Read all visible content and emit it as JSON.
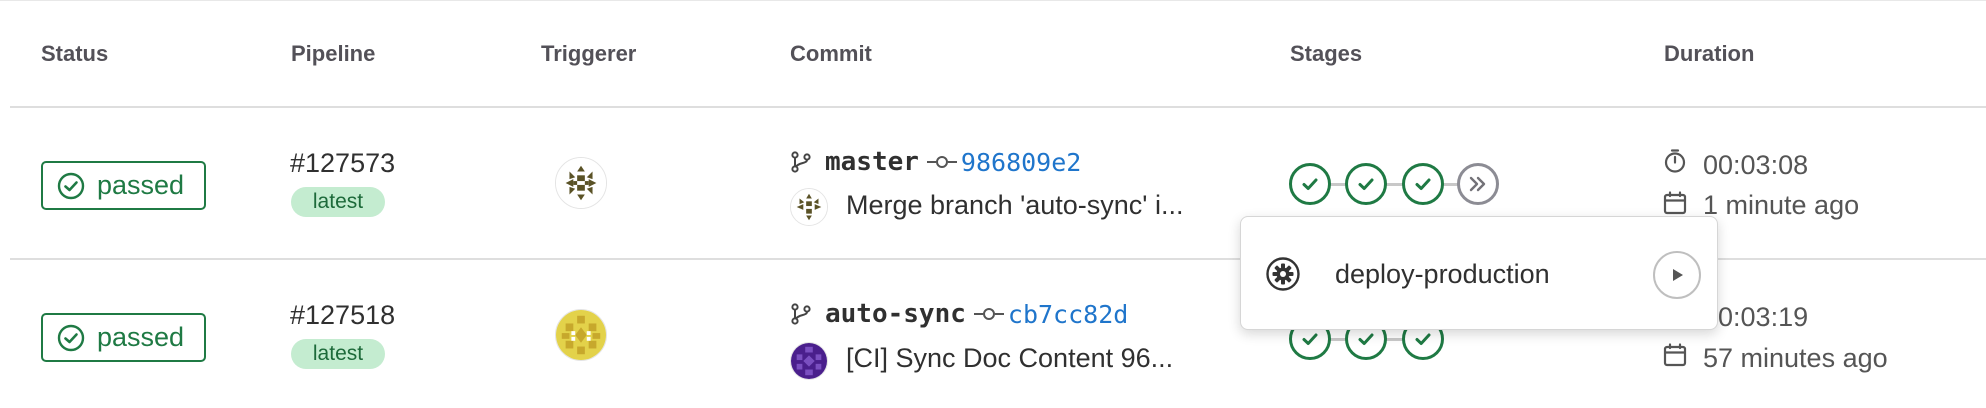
{
  "headers": {
    "status": "Status",
    "pipeline": "Pipeline",
    "triggerer": "Triggerer",
    "commit": "Commit",
    "stages": "Stages",
    "duration": "Duration"
  },
  "rows": [
    {
      "status": "passed",
      "pipeline_id": "#127573",
      "tag": "latest",
      "branch": "master",
      "sha": "986809e2",
      "message": "Merge branch 'auto-sync' i...",
      "stages": [
        "passed",
        "passed",
        "passed",
        "manual"
      ],
      "duration": "00:03:08",
      "finished": "1 minute ago"
    },
    {
      "status": "passed",
      "pipeline_id": "#127518",
      "tag": "latest",
      "branch": "auto-sync",
      "sha": "cb7cc82d",
      "message": "[CI] Sync Doc Content 96...",
      "stages": [
        "passed",
        "passed",
        "passed"
      ],
      "duration": "00:03:19",
      "finished": "57 minutes ago"
    }
  ],
  "popover": {
    "job_name": "deploy-production",
    "job_icon": "gear-icon",
    "action_icon": "play-icon"
  },
  "colors": {
    "success": "#1f7a44",
    "link": "#1f75cb",
    "latest_badge_bg": "#c4ecd0",
    "manual": "#8c8c94"
  }
}
